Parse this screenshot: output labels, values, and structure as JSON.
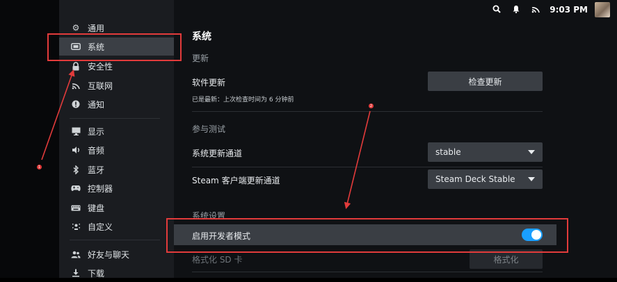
{
  "status_bar": {
    "icons": [
      "search-icon",
      "bell-icon",
      "wifi-icon"
    ],
    "time": "9:03 PM"
  },
  "sidebar": {
    "items": [
      {
        "label": "通用",
        "icon": "gear-icon"
      },
      {
        "label": "系统",
        "icon": "system-icon",
        "active": true
      },
      {
        "label": "安全性",
        "icon": "lock-icon"
      },
      {
        "label": "互联网",
        "icon": "wifi-icon"
      },
      {
        "label": "通知",
        "icon": "info-icon"
      },
      {
        "label": "显示",
        "icon": "monitor-icon"
      },
      {
        "label": "音频",
        "icon": "speaker-icon"
      },
      {
        "label": "蓝牙",
        "icon": "bluetooth-icon"
      },
      {
        "label": "控制器",
        "icon": "gamepad-icon"
      },
      {
        "label": "键盘",
        "icon": "keyboard-icon"
      },
      {
        "label": "自定义",
        "icon": "customize-icon"
      },
      {
        "label": "好友与聊天",
        "icon": "friends-icon"
      },
      {
        "label": "下载",
        "icon": "download-icon"
      }
    ]
  },
  "main": {
    "title": "系统",
    "update_section": {
      "heading": "更新",
      "software_update_label": "软件更新",
      "check_button": "检查更新",
      "last_checked": "已是最新：上次检查时间为 6 分钟前"
    },
    "beta_section": {
      "heading": "参与测试",
      "os_channel_label": "系统更新通道",
      "os_channel_value": "stable",
      "client_channel_label": "Steam 客户端更新通道",
      "client_channel_value": "Steam Deck Stable"
    },
    "system_settings": {
      "heading": "系统设置",
      "developer_mode_label": "启用开发者模式",
      "developer_mode_on": true,
      "format_sd_label": "格式化 SD 卡",
      "format_button": "格式化"
    }
  },
  "annotations": {
    "marker_1": "1",
    "marker_2": "2",
    "color": "#e23b3b"
  },
  "colors": {
    "accent": "#1a9fff",
    "active_bg": "#3b3f45"
  }
}
